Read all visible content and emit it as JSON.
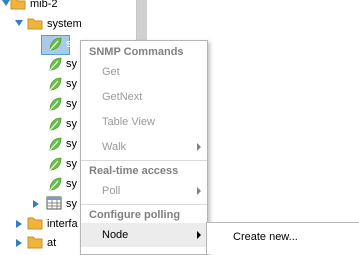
{
  "tree": {
    "root": {
      "label": "mib-2"
    },
    "system": {
      "label": "system"
    },
    "children": [
      {
        "label": "sy"
      },
      {
        "label": "sy"
      },
      {
        "label": "sy"
      },
      {
        "label": "sy"
      },
      {
        "label": "sy"
      },
      {
        "label": "sy"
      },
      {
        "label": "sy"
      },
      {
        "label": "sy"
      }
    ],
    "table_child": {
      "label": "sy"
    },
    "interfaces": {
      "label": "interfa"
    },
    "at": {
      "label": "at"
    }
  },
  "context_menu": {
    "snmp_header": "SNMP Commands",
    "get": "Get",
    "getnext": "GetNext",
    "table_view": "Table View",
    "walk": "Walk",
    "realtime_header": "Real-time access",
    "poll": "Poll",
    "polling_header": "Configure polling",
    "node": "Node"
  },
  "submenu": {
    "create_new": "Create new..."
  },
  "colors": {
    "folder": "#f0b43c",
    "leaf": "#6cbf4b",
    "toggle": "#2f7fc1",
    "selection": "#a9cbe8"
  }
}
